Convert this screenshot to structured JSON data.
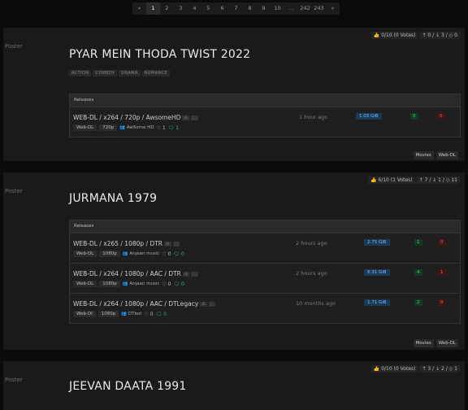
{
  "pagination": [
    "«",
    "1",
    "2",
    "3",
    "4",
    "5",
    "6",
    "7",
    "8",
    "9",
    "10",
    "...",
    "242",
    "243",
    "»"
  ],
  "cards": [
    {
      "poster": "Poster",
      "votes": [
        "👍 0/10 (0 Votes)",
        "↑ 0 / ↓ 3 / ◇ 0"
      ],
      "title": "PYAR MEIN THODA TWIST 2022",
      "genres": [
        "ACTION",
        "COMEDY",
        "DRAMA",
        "ROMANCE"
      ],
      "table_header": "Releases",
      "releases": [
        {
          "name": "WEB-DL / x264 / 720p / AwsomeHD",
          "icons": [
            "⚠",
            "⬚"
          ],
          "source": "Web-DL",
          "res": "720p",
          "uploader": "AwSome HD",
          "hearts": "♡ 1",
          "comments": "🗨 1",
          "age": "1 hour ago",
          "size": "1.03 GiB",
          "seeders": "0",
          "leechers": "0"
        }
      ],
      "buttons": [
        "Movies",
        "Web-DL"
      ]
    },
    {
      "poster": "Poster",
      "votes": [
        "👍 6/10 (1 Votes)",
        "↑ 7 / ↓ 1 / ◇ 11"
      ],
      "title": "JURMANA 1979",
      "genres": [],
      "table_header": "Releases",
      "releases": [
        {
          "name": "WEB-DL / x265 / 1080p / DTR",
          "icons": [
            "⚠",
            "⬚"
          ],
          "source": "Web-DL",
          "res": "1080p",
          "uploader": "Anjaan music",
          "hearts": "♡ 0",
          "comments": "🗨 0",
          "age": "2 hours ago",
          "size": "2.75 GiB",
          "seeders": "1",
          "leechers": "0"
        },
        {
          "name": "WEB-DL / x264 / 1080p / AAC / DTR",
          "icons": [
            "⚠",
            "⬚"
          ],
          "source": "Web-DL",
          "res": "1080p",
          "uploader": "Anjaan music",
          "hearts": "♡ 0",
          "comments": "🗨 0",
          "age": "2 hours ago",
          "size": "8.31 GiB",
          "seeders": "4",
          "leechers": "1"
        },
        {
          "name": "WEB-DL / x264 / 1080p / AAC / DTLegacy",
          "icons": [
            "⚠",
            "⬚"
          ],
          "source": "Web-Dl",
          "res": "1080p",
          "uploader": "DTbot",
          "hearts": "♡ 0",
          "comments": "🗨 0",
          "age": "10 months ago",
          "size": "1.71 GiB",
          "seeders": "2",
          "leechers": "0"
        }
      ],
      "buttons": [
        "Movies",
        "Web-DL"
      ]
    },
    {
      "poster": "Poster",
      "votes": [
        "👍 0/10 (0 Votes)",
        "↑ 3 / ↓ 2 / ◇ 1"
      ],
      "title": "JEEVAN DAATA 1991",
      "genres": [],
      "table_header": "",
      "releases": [],
      "buttons": []
    }
  ]
}
